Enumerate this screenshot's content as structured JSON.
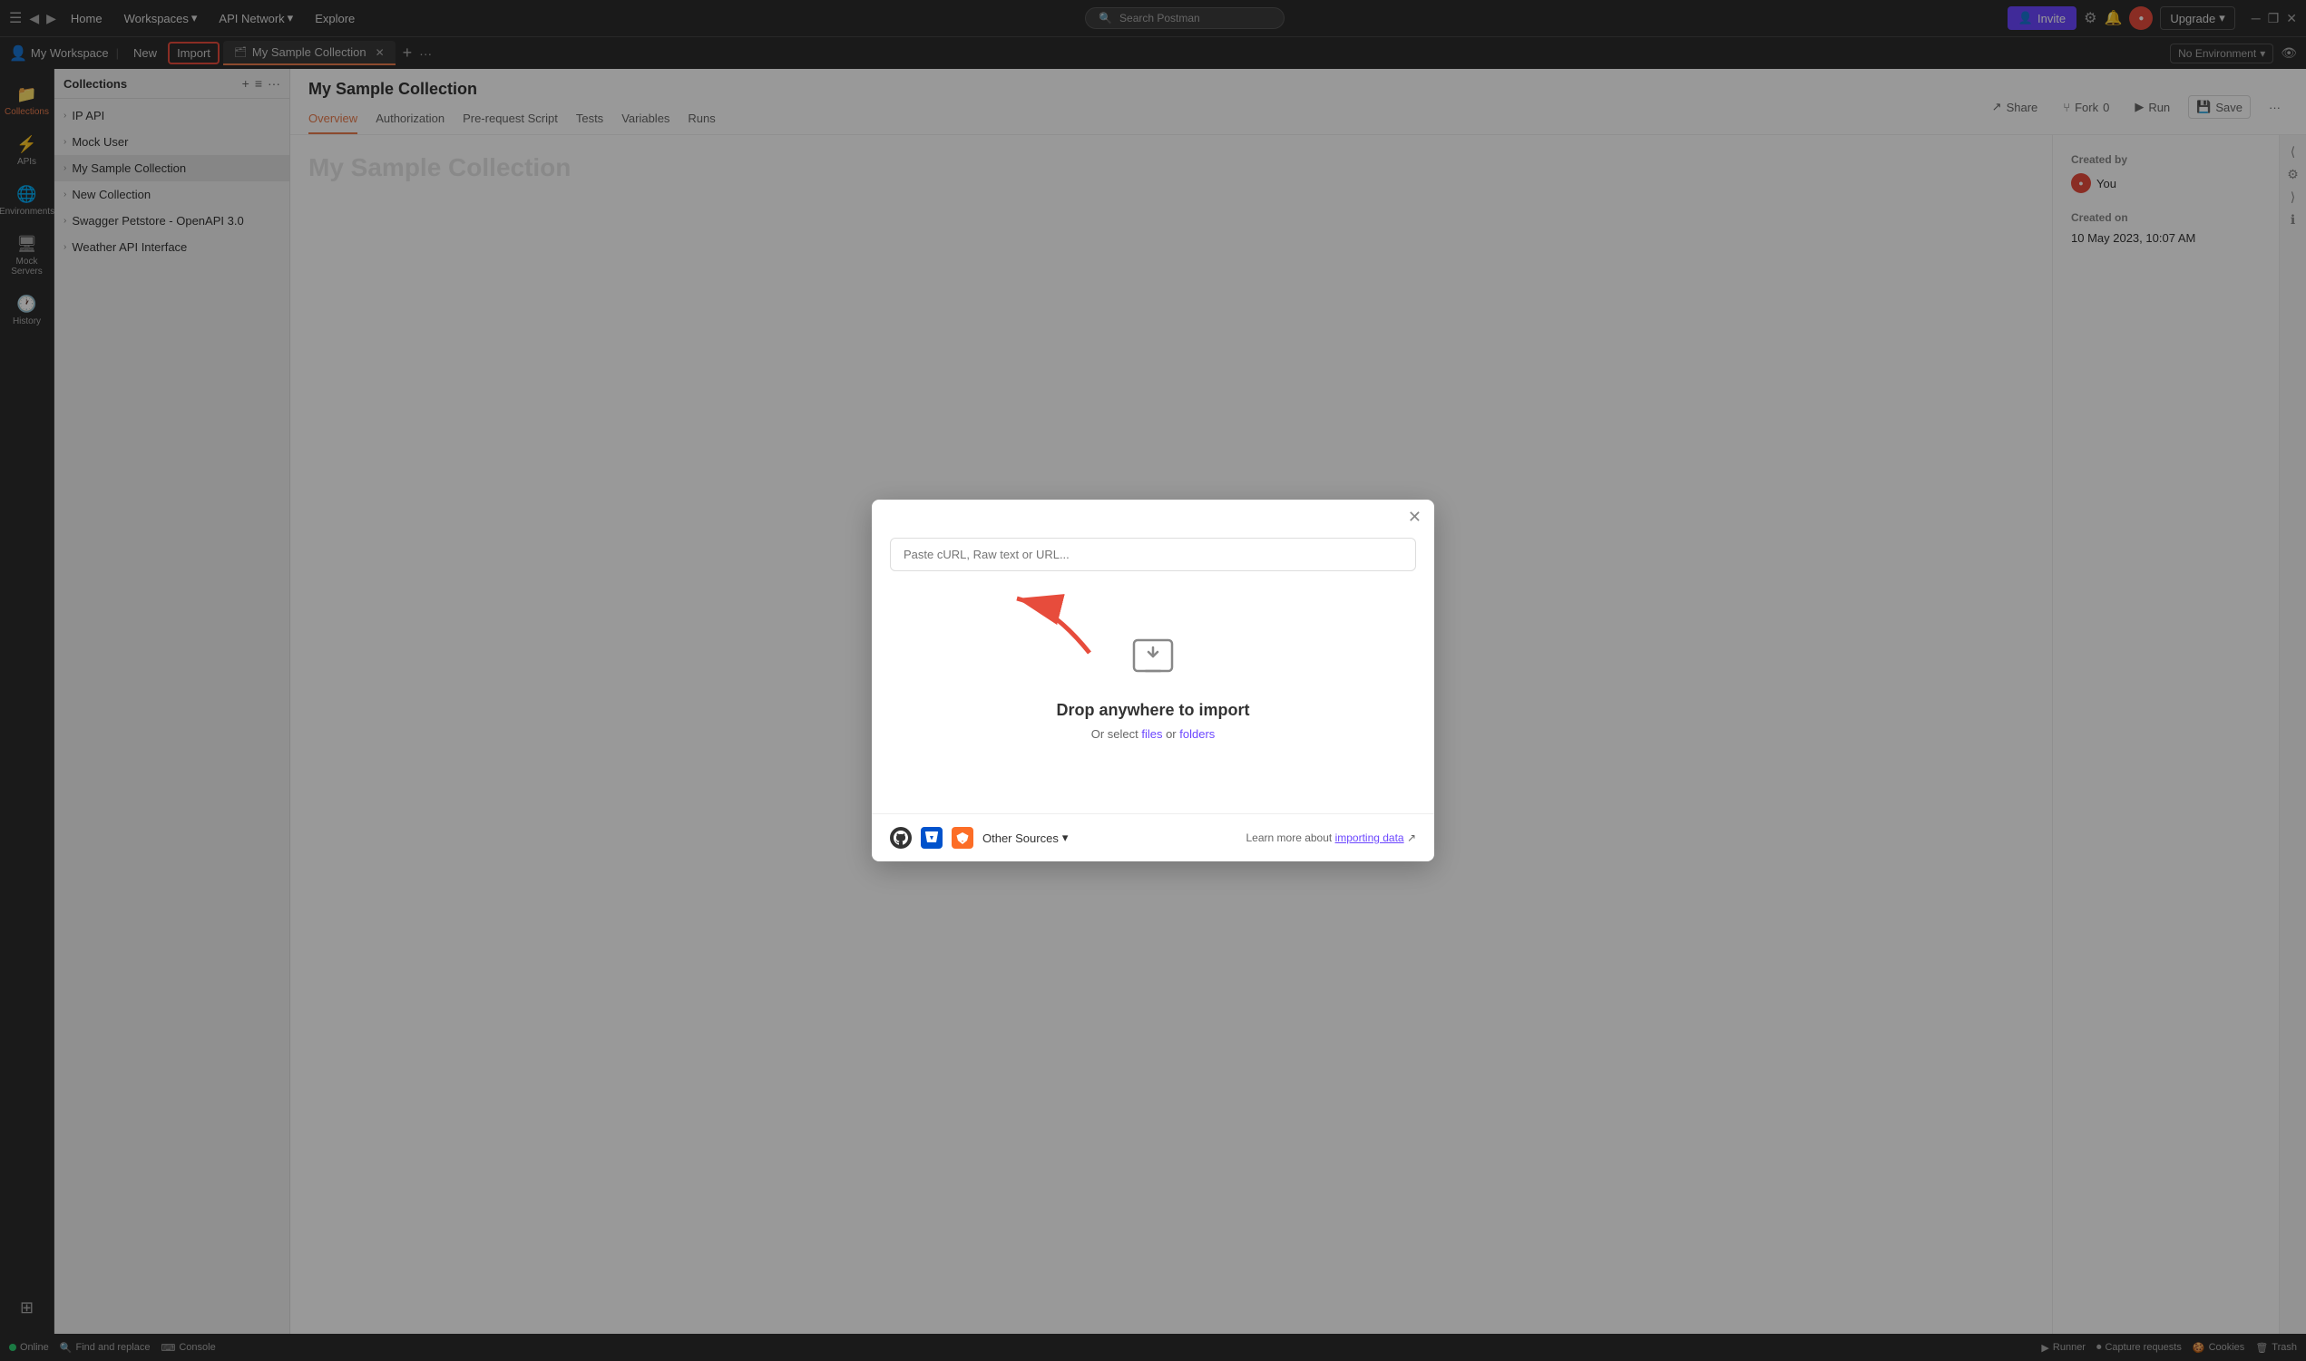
{
  "topbar": {
    "home": "Home",
    "workspaces": "Workspaces",
    "api_network": "API Network",
    "explore": "Explore",
    "search_placeholder": "Search Postman",
    "invite_label": "Invite",
    "upgrade_label": "Upgrade",
    "workspace_name": "My Workspace"
  },
  "tabs": {
    "new_label": "New",
    "import_label": "Import",
    "tab_name": "My Sample Collection",
    "no_environment": "No Environment"
  },
  "sidebar": {
    "items": [
      {
        "id": "collections",
        "label": "Collections",
        "icon": "📁"
      },
      {
        "id": "apis",
        "label": "APIs",
        "icon": "⚡"
      },
      {
        "id": "environments",
        "label": "Environments",
        "icon": "🌐"
      },
      {
        "id": "mock-servers",
        "label": "Mock Servers",
        "icon": "🖥"
      },
      {
        "id": "history",
        "label": "History",
        "icon": "🕐"
      },
      {
        "id": "extensions",
        "label": "Extensions",
        "icon": "⊞"
      }
    ]
  },
  "collections": {
    "panel_header": "Collections",
    "items": [
      {
        "name": "IP API",
        "id": "ip-api"
      },
      {
        "name": "Mock User",
        "id": "mock-user"
      },
      {
        "name": "My Sample Collection",
        "id": "my-sample",
        "active": true
      },
      {
        "name": "New Collection",
        "id": "new-collection"
      },
      {
        "name": "Swagger Petstore - OpenAPI 3.0",
        "id": "swagger"
      },
      {
        "name": "Weather API Interface",
        "id": "weather-api"
      }
    ]
  },
  "content": {
    "title": "My Sample Collection",
    "tabs": [
      "Overview",
      "Authorization",
      "Pre-request Script",
      "Tests",
      "Variables",
      "Runs"
    ],
    "active_tab": "Overview",
    "actions": {
      "share": "Share",
      "fork": "Fork",
      "fork_count": "0",
      "run": "Run",
      "save": "Save"
    },
    "meta": {
      "created_by_label": "Created by",
      "created_by": "You",
      "created_on_label": "Created on",
      "created_on": "10 May 2023, 10:07 AM"
    },
    "bg_title": "My Sample Collection"
  },
  "modal": {
    "url_placeholder": "Paste cURL, Raw text or URL...",
    "drop_title": "Drop anywhere to import",
    "drop_subtitle_prefix": "Or select ",
    "files_label": "files",
    "or_label": " or ",
    "folders_label": "folders",
    "other_sources_label": "Other Sources",
    "footer_text": "Learn more about ",
    "importing_data_label": "importing data",
    "footer_link_suffix": " ↗"
  },
  "statusbar": {
    "online": "Online",
    "find_replace": "Find and replace",
    "console": "Console",
    "runner": "Runner",
    "capture_requests": "Capture requests",
    "cookies": "Cookies",
    "trash": "Trash"
  },
  "colors": {
    "accent": "#e97c4e",
    "purple": "#6c47ff",
    "red": "#e74c3c",
    "import_border": "#e74c3c"
  }
}
